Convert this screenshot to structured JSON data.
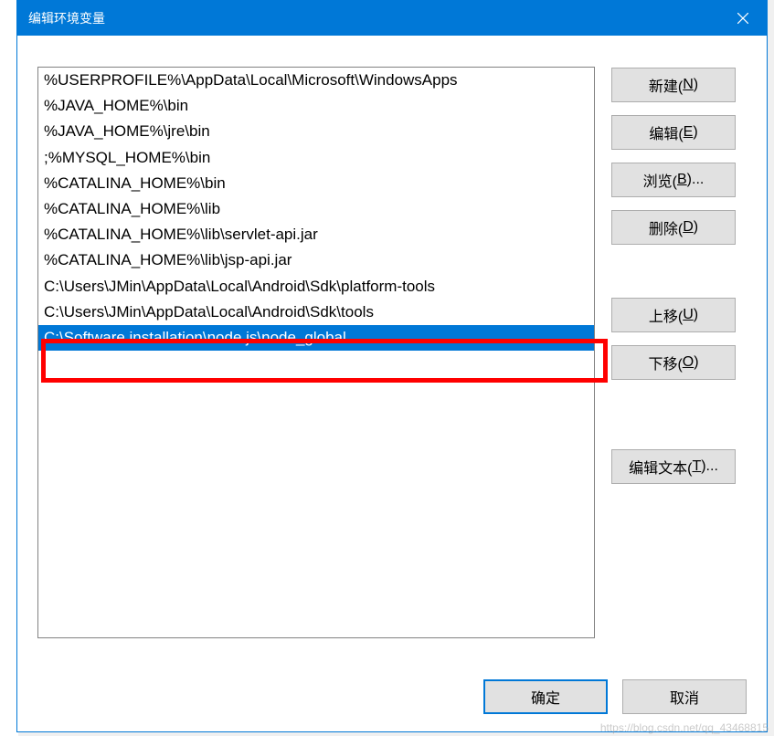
{
  "window": {
    "title": "编辑环境变量"
  },
  "list": {
    "items": [
      "%USERPROFILE%\\AppData\\Local\\Microsoft\\WindowsApps",
      "%JAVA_HOME%\\bin",
      "%JAVA_HOME%\\jre\\bin",
      ";%MYSQL_HOME%\\bin",
      "%CATALINA_HOME%\\bin",
      "%CATALINA_HOME%\\lib",
      "%CATALINA_HOME%\\lib\\servlet-api.jar",
      "%CATALINA_HOME%\\lib\\jsp-api.jar",
      "C:\\Users\\JMin\\AppData\\Local\\Android\\Sdk\\platform-tools",
      "C:\\Users\\JMin\\AppData\\Local\\Android\\Sdk\\tools",
      "C:\\Software installation\\node.js\\node_global"
    ],
    "selectedIndex": 10
  },
  "buttons": {
    "new": {
      "text": "新建(",
      "key": "N",
      "suffix": ")"
    },
    "edit": {
      "text": "编辑(",
      "key": "E",
      "suffix": ")"
    },
    "browse": {
      "text": "浏览(",
      "key": "B",
      "suffix": ")..."
    },
    "delete": {
      "text": "删除(",
      "key": "D",
      "suffix": ")"
    },
    "moveUp": {
      "text": "上移(",
      "key": "U",
      "suffix": ")"
    },
    "moveDown": {
      "text": "下移(",
      "key": "O",
      "suffix": ")"
    },
    "editText": {
      "text": "编辑文本(",
      "key": "T",
      "suffix": ")..."
    }
  },
  "footer": {
    "ok": "确定",
    "cancel": "取消"
  },
  "watermark": "https://blog.csdn.net/qq_43468815"
}
